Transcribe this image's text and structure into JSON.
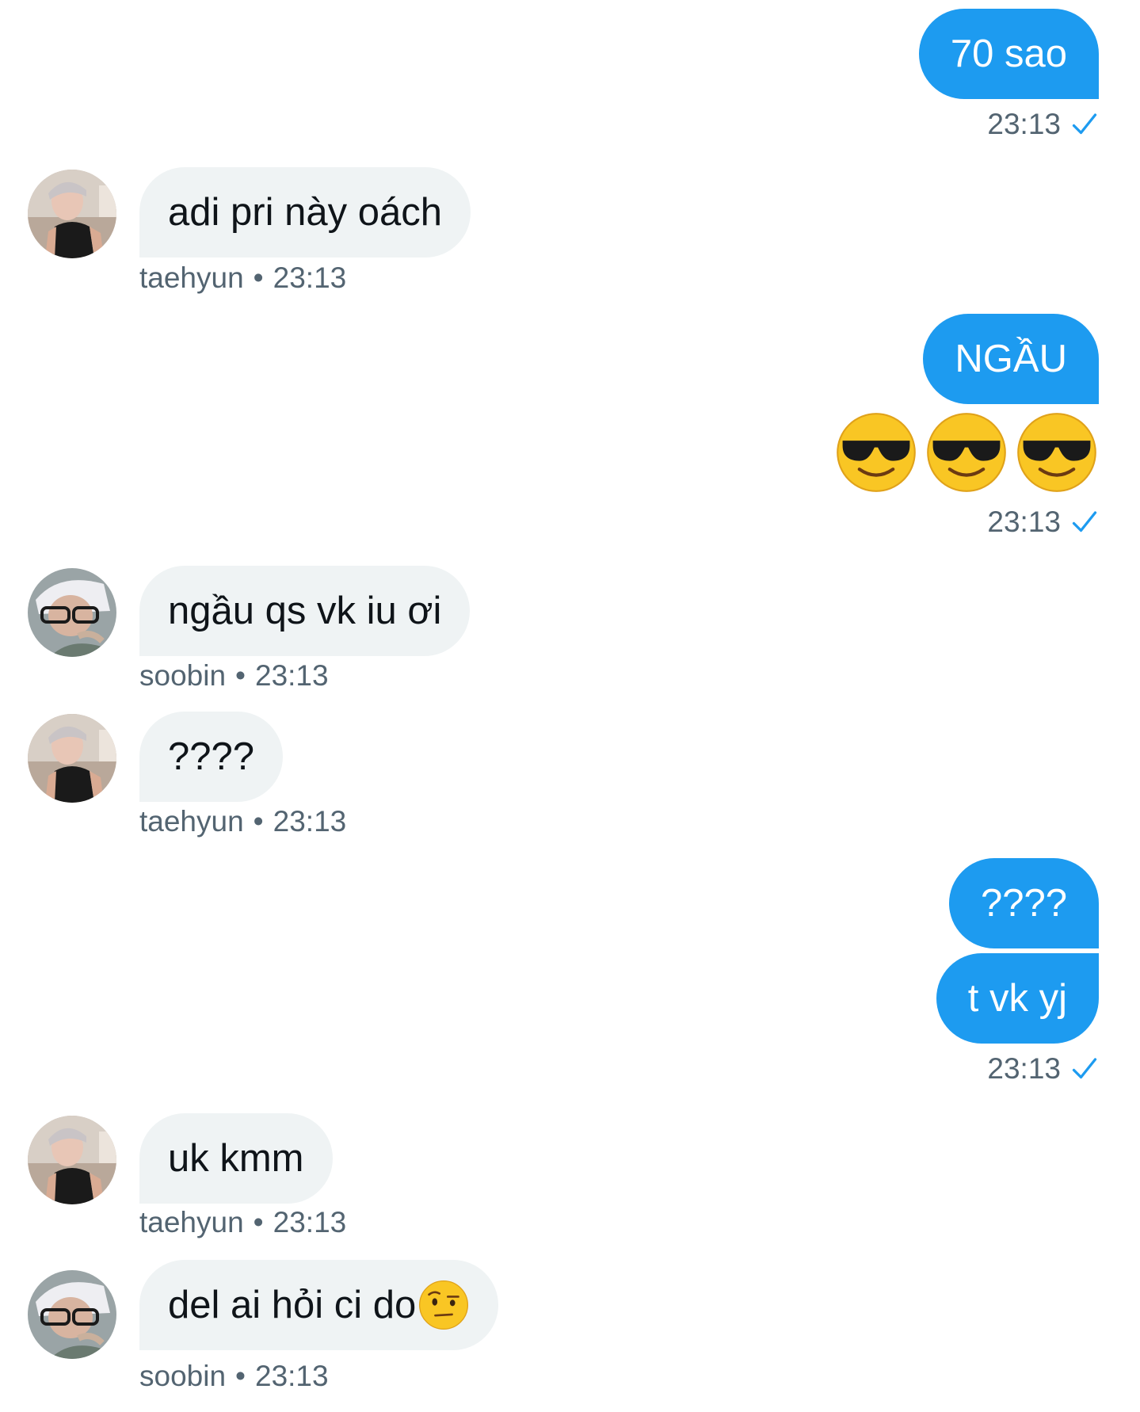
{
  "messages": [
    {
      "from": "me",
      "text": "70 sao",
      "time": "23:13"
    },
    {
      "from": "taehyun",
      "text": "adi pri này oách",
      "sender": "taehyun",
      "time": "23:13"
    },
    {
      "from": "me",
      "text": "NGẦU",
      "emojis": [
        "smiling-face-with-sunglasses",
        "smiling-face-with-sunglasses",
        "smiling-face-with-sunglasses"
      ],
      "time": "23:13"
    },
    {
      "from": "soobin",
      "text": "ngầu qs vk iu ơi",
      "sender": "soobin",
      "time": "23:13"
    },
    {
      "from": "taehyun",
      "text": "????",
      "sender": "taehyun",
      "time": "23:13"
    },
    {
      "from": "me",
      "text": "????",
      "text2": "t vk yj",
      "time": "23:13"
    },
    {
      "from": "taehyun",
      "text": "uk kmm",
      "sender": "taehyun",
      "time": "23:13"
    },
    {
      "from": "soobin",
      "text": "del ai hỏi ci do",
      "emoji": "face-with-raised-eyebrow",
      "sender": "soobin",
      "time": "23:13"
    }
  ],
  "separator": "•",
  "colors": {
    "outgoing_bubble": "#1d9bf0",
    "incoming_bubble": "#eff3f4",
    "meta_text": "#536471",
    "check": "#1d9bf0"
  },
  "icons": {
    "read_receipt": "check-icon",
    "avatar_taehyun": "avatar",
    "avatar_soobin": "avatar"
  }
}
